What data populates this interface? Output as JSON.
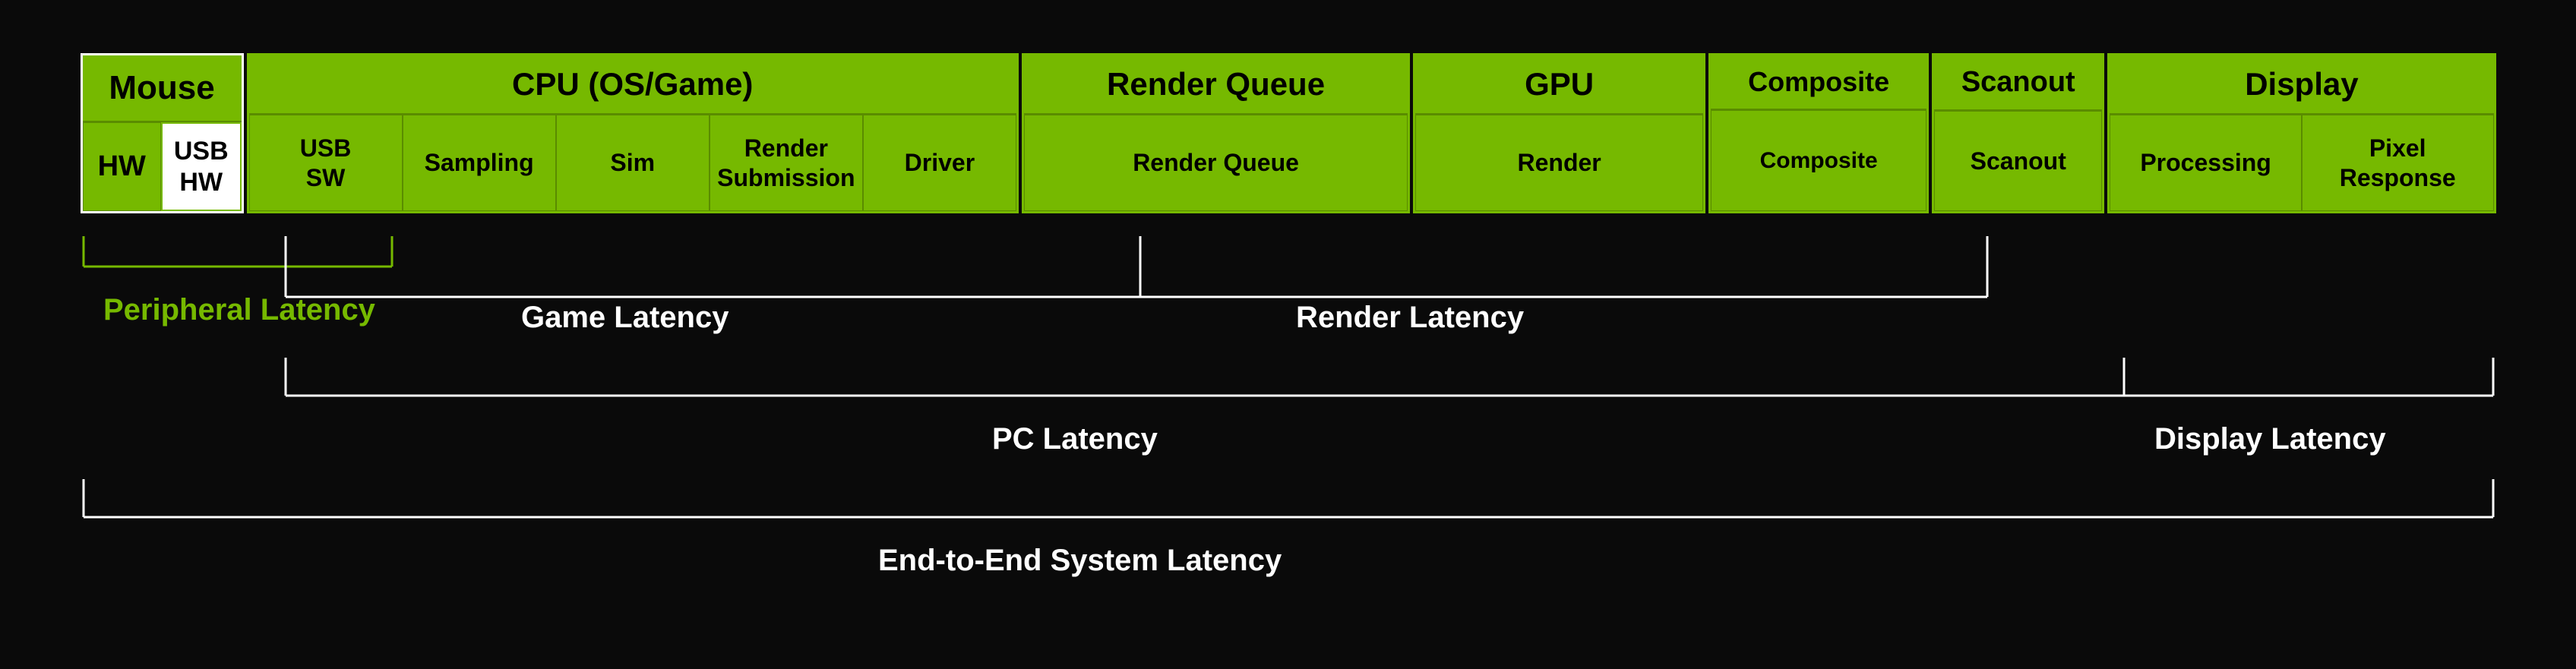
{
  "diagram": {
    "groups": [
      {
        "id": "mouse",
        "header": "Mouse",
        "whiteBorder": true,
        "subBlocks": [
          {
            "label": "HW"
          },
          {
            "label": "USB\nHW",
            "whiteBackground": true
          }
        ]
      },
      {
        "id": "cpu",
        "header": "CPU (OS/Game)",
        "subBlocks": [
          {
            "label": "USB\nSW"
          },
          {
            "label": "Sampling"
          },
          {
            "label": "Sim"
          },
          {
            "label": "Render\nSubmission"
          },
          {
            "label": "Driver"
          }
        ]
      },
      {
        "id": "renderqueue",
        "header": "Render Queue",
        "subBlocks": [
          {
            "label": "Render Queue"
          }
        ]
      },
      {
        "id": "gpu",
        "header": "GPU",
        "subBlocks": [
          {
            "label": "Render"
          }
        ]
      },
      {
        "id": "composite",
        "header": "Composite",
        "subBlocks": [
          {
            "label": "Composite"
          }
        ]
      },
      {
        "id": "scanout",
        "header": "Scanout",
        "subBlocks": [
          {
            "label": "Scanout"
          }
        ]
      },
      {
        "id": "display",
        "header": "Display",
        "subBlocks": [
          {
            "label": "Processing"
          },
          {
            "label": "Pixel\nResponse"
          }
        ]
      }
    ],
    "latencies": [
      {
        "id": "peripheral",
        "label": "Peripheral Latency",
        "color": "green",
        "startFraction": 0.0,
        "endFraction": 0.135
      },
      {
        "id": "game",
        "label": "Game Latency",
        "color": "white",
        "startFraction": 0.085,
        "endFraction": 0.44
      },
      {
        "id": "render",
        "label": "Render Latency",
        "color": "white",
        "startFraction": 0.44,
        "endFraction": 0.79
      },
      {
        "id": "pc",
        "label": "PC Latency",
        "color": "white",
        "startFraction": 0.085,
        "endFraction": 0.845
      },
      {
        "id": "display",
        "label": "Display Latency",
        "color": "white",
        "startFraction": 0.845,
        "endFraction": 1.0
      },
      {
        "id": "e2e",
        "label": "End-to-End System Latency",
        "color": "white",
        "startFraction": 0.0,
        "endFraction": 1.0
      }
    ]
  }
}
